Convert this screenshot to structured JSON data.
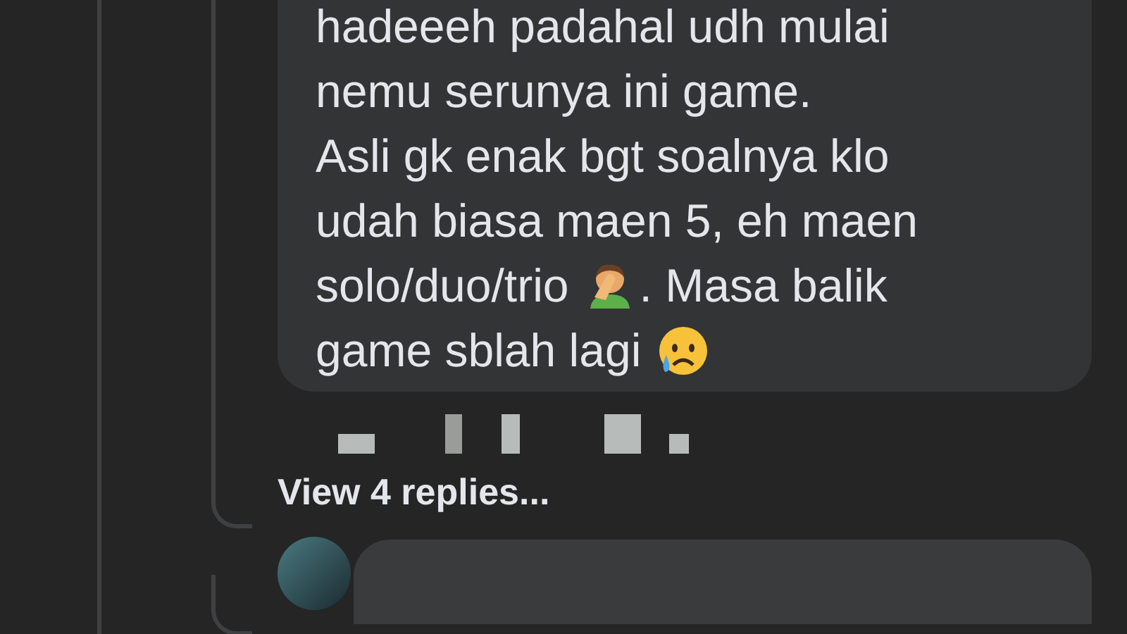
{
  "comment": {
    "lines": [
      {
        "parts": [
          {
            "kind": "text",
            "text": "hadeeeh padahal udh mulai"
          }
        ]
      },
      {
        "parts": [
          {
            "kind": "text",
            "text": "nemu serunya ini game."
          }
        ]
      },
      {
        "parts": [
          {
            "kind": "text",
            "text": "Asli gk enak bgt soalnya klo"
          }
        ]
      },
      {
        "parts": [
          {
            "kind": "text",
            "text": "udah biasa maen 5, eh maen"
          }
        ]
      },
      {
        "parts": [
          {
            "kind": "text",
            "text": "solo/duo/trio"
          },
          {
            "kind": "facepalm"
          },
          {
            "kind": "text",
            "text": ". Masa balik"
          }
        ]
      },
      {
        "parts": [
          {
            "kind": "text",
            "text": "game sblah lagi"
          },
          {
            "kind": "crying"
          }
        ]
      }
    ]
  },
  "view_replies": {
    "label": "View 4 replies..."
  }
}
